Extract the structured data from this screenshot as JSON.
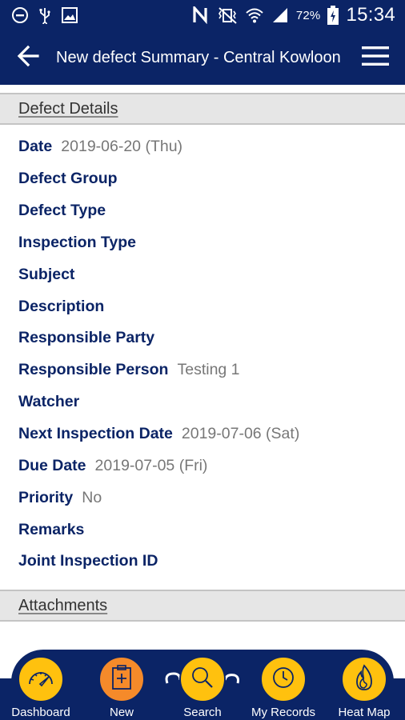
{
  "status_bar": {
    "battery_percent": "72%",
    "time": "15:34",
    "icons": [
      "do-not-disturb-icon",
      "usb-icon",
      "image-icon",
      "nfc-icon",
      "vibrate-icon",
      "wifi-icon",
      "signal-icon",
      "battery-icon"
    ]
  },
  "app_bar": {
    "title": "New defect Summary - Central Kowloon",
    "back_icon": "arrow-left-icon",
    "menu_icon": "hamburger-menu-icon"
  },
  "sections": {
    "details_title": "Defect Details",
    "attachments_title": "Attachments"
  },
  "fields": [
    {
      "label": "Date",
      "value": "2019-06-20 (Thu)"
    },
    {
      "label": "Defect Group",
      "value": ""
    },
    {
      "label": "Defect Type",
      "value": ""
    },
    {
      "label": "Inspection Type",
      "value": ""
    },
    {
      "label": "Subject",
      "value": ""
    },
    {
      "label": "Description",
      "value": ""
    },
    {
      "label": "Responsible Party",
      "value": ""
    },
    {
      "label": "Responsible Person",
      "value": "Testing 1"
    },
    {
      "label": "Watcher",
      "value": ""
    },
    {
      "label": "Next Inspection Date",
      "value": "2019-07-06 (Sat)"
    },
    {
      "label": "Due Date",
      "value": "2019-07-05 (Fri)"
    },
    {
      "label": "Priority",
      "value": "No"
    },
    {
      "label": "Remarks",
      "value": ""
    },
    {
      "label": "Joint Inspection ID",
      "value": ""
    }
  ],
  "bottom_nav": {
    "items": [
      {
        "label": "Dashboard",
        "icon": "speedometer-icon",
        "active": false
      },
      {
        "label": "New",
        "icon": "clipboard-plus-icon",
        "active": true
      },
      {
        "label": "Search",
        "icon": "search-icon",
        "active": false
      },
      {
        "label": "My Records",
        "icon": "clock-icon",
        "active": false
      },
      {
        "label": "Heat Map",
        "icon": "flame-icon",
        "active": false
      }
    ]
  },
  "colors": {
    "brand_navy": "#0b2466",
    "nav_yellow": "#ffc10e",
    "nav_active_orange": "#f58a2a",
    "value_gray": "#777777"
  }
}
